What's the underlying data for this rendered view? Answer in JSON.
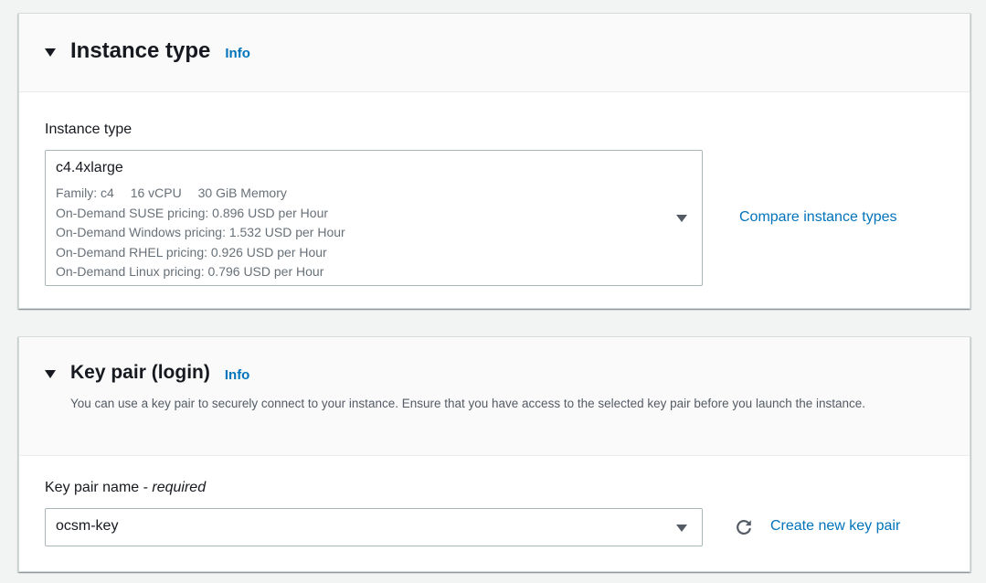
{
  "instance_type_panel": {
    "title": "Instance type",
    "info_label": "Info",
    "field_label": "Instance type",
    "selected": {
      "name": "c4.4xlarge",
      "family": "Family: c4",
      "vcpu": "16 vCPU",
      "memory": "30 GiB Memory",
      "pricing": [
        "On-Demand SUSE pricing: 0.896 USD per Hour",
        "On-Demand Windows pricing: 1.532 USD per Hour",
        "On-Demand RHEL pricing: 0.926 USD per Hour",
        "On-Demand Linux pricing: 0.796 USD per Hour"
      ]
    },
    "compare_link": "Compare instance types"
  },
  "key_pair_panel": {
    "title": "Key pair (login)",
    "info_label": "Info",
    "description": "You can use a key pair to securely connect to your instance. Ensure that you have access to the selected key pair before you launch the instance.",
    "field_label": "Key pair name - ",
    "field_label_required": "required",
    "selected_value": "ocsm-key",
    "refresh_icon": "refresh-icon",
    "create_link": "Create new key pair"
  },
  "colors": {
    "link": "#0073bb",
    "page_background": "#f2f3f3",
    "header_background": "#fafafa",
    "border": "#aab7b8"
  }
}
